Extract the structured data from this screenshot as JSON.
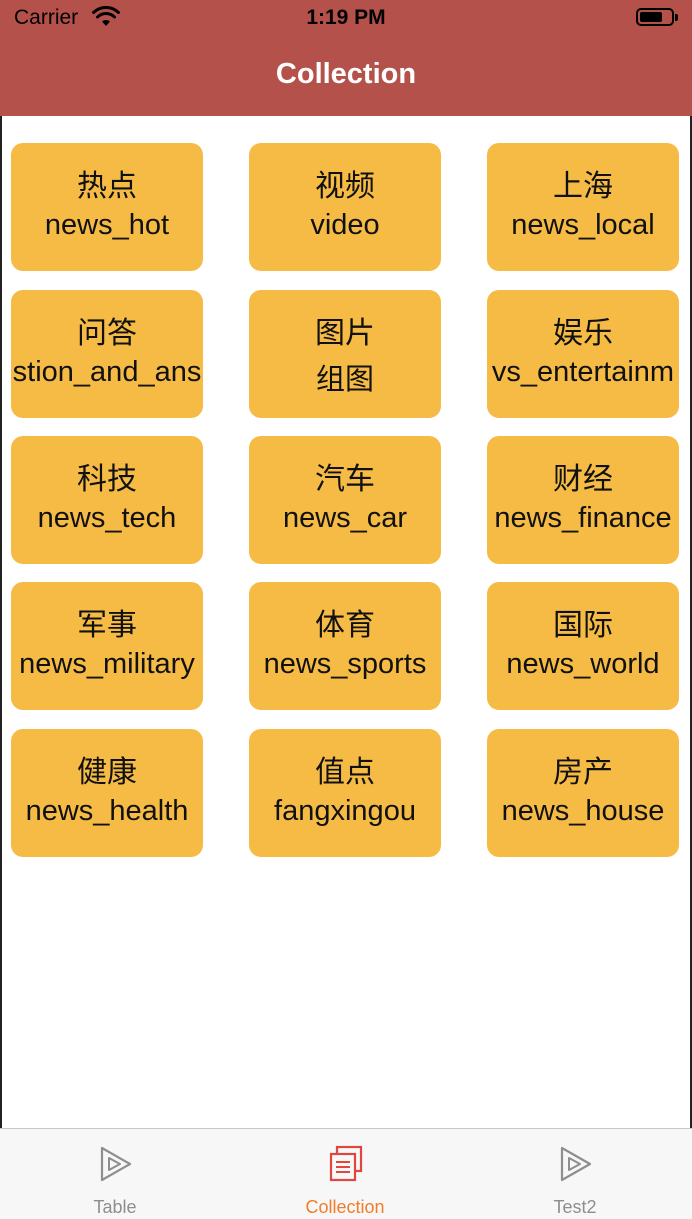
{
  "status_bar": {
    "carrier": "Carrier",
    "time": "1:19 PM",
    "icons": [
      "wifi-icon",
      "battery-icon"
    ]
  },
  "nav": {
    "title": "Collection"
  },
  "colors": {
    "nav_background": "#b4514a",
    "cell_background": "#f5bb45",
    "tab_active": "#ef7d2a",
    "tab_inactive": "#8e8e8e"
  },
  "cells": [
    {
      "zh": "热点",
      "en": "news_hot"
    },
    {
      "zh": "视频",
      "en": "video"
    },
    {
      "zh": "上海",
      "en": "news_local"
    },
    {
      "zh": "问答",
      "en": "stion_and_ans"
    },
    {
      "zh": "图片",
      "en": "组图"
    },
    {
      "zh": "娱乐",
      "en": "vs_entertainm"
    },
    {
      "zh": "科技",
      "en": "news_tech"
    },
    {
      "zh": "汽车",
      "en": "news_car"
    },
    {
      "zh": "财经",
      "en": "news_finance"
    },
    {
      "zh": "军事",
      "en": "news_military"
    },
    {
      "zh": "体育",
      "en": "news_sports"
    },
    {
      "zh": "国际",
      "en": "news_world"
    },
    {
      "zh": "健康",
      "en": "news_health"
    },
    {
      "zh": "值点",
      "en": "fangxingou"
    },
    {
      "zh": "房产",
      "en": "news_house"
    }
  ],
  "tabs": [
    {
      "label": "Table",
      "icon": "play-triangle-icon",
      "active": false
    },
    {
      "label": "Collection",
      "icon": "stacked-documents-icon",
      "active": true
    },
    {
      "label": "Test2",
      "icon": "play-triangle-icon",
      "active": false
    }
  ]
}
